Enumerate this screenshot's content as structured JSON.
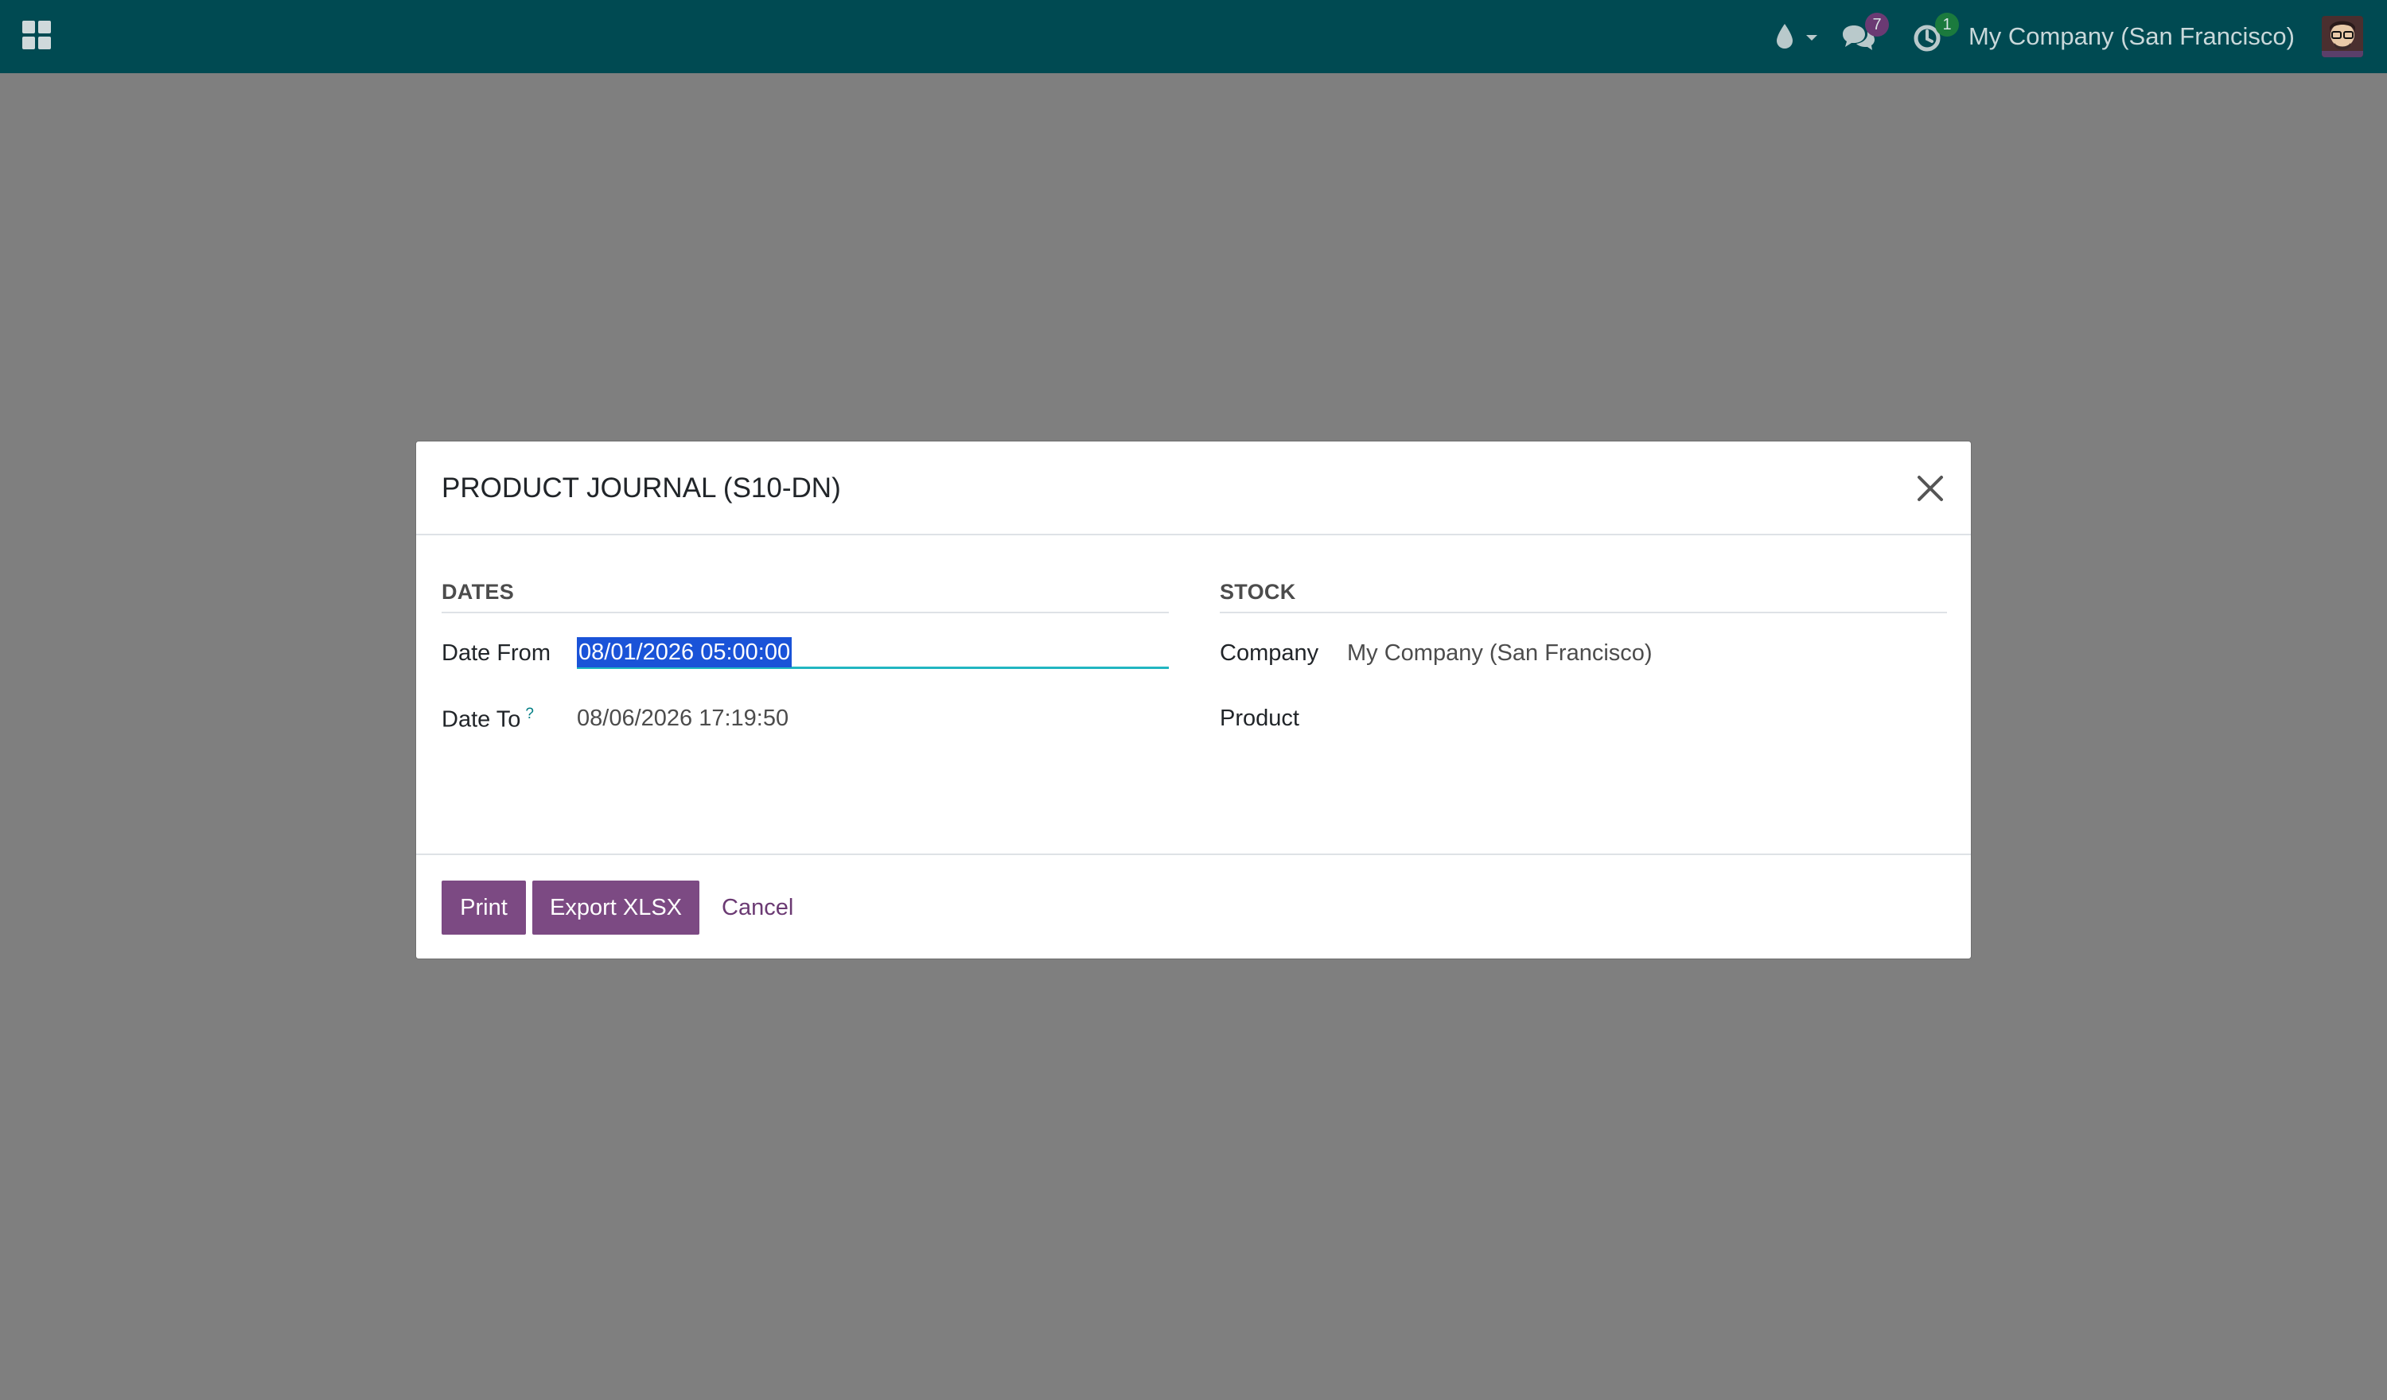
{
  "navbar": {
    "apps_icon": "apps-grid-icon",
    "drop_icon": "drop-icon",
    "messages_icon": "chat-bubbles-icon",
    "messages_count": "7",
    "activity_icon": "clock-icon",
    "activity_count": "1",
    "company": "My Company (San Francisco)",
    "avatar": "avatar",
    "bar_color": "#004a52",
    "messages_badge_color": "#6b3a73",
    "activity_badge_color": "#1b7a3d"
  },
  "dialog": {
    "title": "PRODUCT JOURNAL (S10-DN)",
    "close_icon": "close-icon",
    "dates_group": {
      "title": "DATES",
      "date_from_label": "Date From",
      "date_from_value": "08/01/2026 05:00:00",
      "date_to_label": "Date To",
      "date_to_help": "?",
      "date_to_value": "08/06/2026 17:19:50"
    },
    "stock_group": {
      "title": "STOCK",
      "company_label": "Company",
      "company_value": "My Company (San Francisco)",
      "product_label": "Product",
      "product_value": ""
    },
    "footer": {
      "print_label": "Print",
      "export_label": "Export XLSX",
      "cancel_label": "Cancel"
    },
    "accent_color": "#7c4a83",
    "focus_color": "#21b6c1",
    "selection_color": "#1a53d8"
  }
}
